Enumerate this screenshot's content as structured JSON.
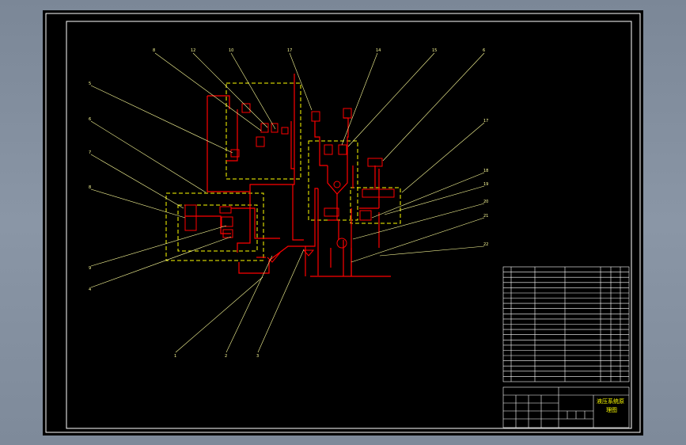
{
  "drawing": {
    "callouts_top": [
      "8",
      "12",
      "10",
      "17",
      "14",
      "15",
      "6"
    ],
    "callouts_left": [
      "5",
      "6",
      "7",
      "8",
      "9",
      "4"
    ],
    "callouts_right": [
      "17",
      "18",
      "19",
      "20",
      "21",
      "22"
    ],
    "callouts_bottom": [
      "1",
      "2",
      "3"
    ]
  },
  "title_block": {
    "title_line1": "液压系统原",
    "title_line2": "理图"
  },
  "colors": {
    "border": "#ffffff",
    "hydraulic_line": "#ff0000",
    "assembly_box": "#ffff00",
    "leader_line": "#ffff99",
    "table_lines": "#ffffff",
    "table_text": "#ffff00"
  }
}
